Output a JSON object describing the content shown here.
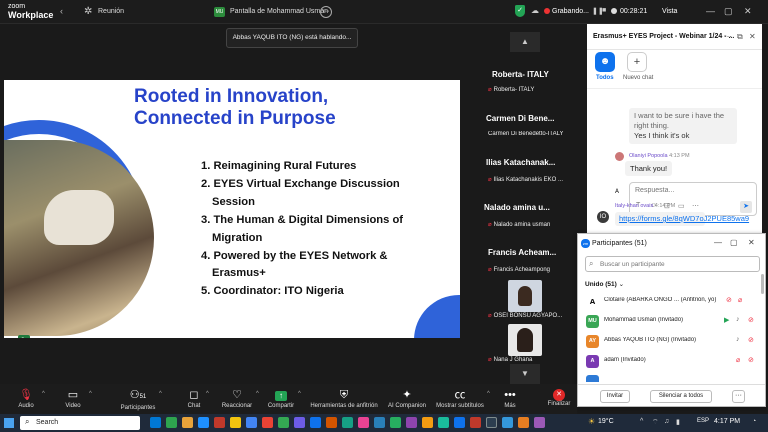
{
  "topbar": {
    "logo_line1": "zoom",
    "logo_line2": "Workplace",
    "meeting_label": "Reunión",
    "share_badge": "MU",
    "share_title": "Pantalla de Mohammad Usman",
    "share_more": "···",
    "recording_label": "Grabando...",
    "timer": "00:28:21",
    "view_label": "Vista"
  },
  "toast": {
    "text": "Abbas YAQUB ITO (NG) está hablando..."
  },
  "slide": {
    "title_line1": "Rooted in Innovation,",
    "title_line2": "Connected in Purpose",
    "items": [
      "1. Reimagining Rural Futures",
      "2. EYES Virtual Exchange Discussion",
      "Session",
      "3. The Human & Digital Dimensions of",
      "Migration",
      "4. Powered by the EYES Network &",
      "Erasmus+",
      "5. Coordinator: ITO Nigeria"
    ]
  },
  "gallery": {
    "tiles": [
      {
        "name": "Roberta- ITALY",
        "sub": "Roberta- ITALY"
      },
      {
        "name": "Carmen Di Bene...",
        "sub": "Carmen Di Benedetto-ITALY"
      },
      {
        "name": "Ilias Katachanak...",
        "sub": "Ilias Katachanakis EKO ..."
      },
      {
        "name": "Nalado amina u...",
        "sub": "Nalado amina usman"
      },
      {
        "name": "Francis Acheam...",
        "sub": "Francis Acheampong"
      },
      {
        "name": "",
        "sub": "OSEI BONSU AGYAPO..."
      },
      {
        "name": "",
        "sub": "Nana J Ghana"
      }
    ]
  },
  "chat": {
    "title": "Erasmus+ EYES Project - Webinar 1/24 - ...",
    "todos_label": "Todos",
    "nuevo_label": "Nuevo chat",
    "msg1_line1": "I want to be sure i have the",
    "msg1_line2": "right thing.",
    "msg1_line3": "Yes I think it's ok",
    "msg2_sender": "Olaniyi Popoola",
    "msg2_time": "4:13 PM",
    "msg2_text": "Thank you!",
    "reply_placeholder": "Respuesta...",
    "msg3_sender": "Italy-khan ovais",
    "msg3_time": "4:14 PM",
    "msg3_link": "https://forms.gle/8qWD7oJ2PUE85wa9"
  },
  "participants": {
    "title": "Participantes (51)",
    "search_placeholder": "Buscar un participante",
    "group_label": "Unido (51)",
    "rows": [
      {
        "initials": "",
        "color": "#2b2b2b",
        "name": "Clotaire (ABARKA ONGO ... (Anfitrión, yo)"
      },
      {
        "initials": "MU",
        "color": "#3aa655",
        "name": "Mohammad Usman (Invitado)"
      },
      {
        "initials": "AY",
        "color": "#e8862a",
        "name": "Abbas YAQUB ITO (NG) (Invitado)"
      },
      {
        "initials": "A",
        "color": "#7a3ab2",
        "name": "adam (Invitado)"
      }
    ],
    "invite_label": "Invitar",
    "mute_all_label": "Silenciar a todos",
    "more_label": "···"
  },
  "toolbar": {
    "audio": "Audio",
    "video": "Video",
    "participants": "Participantes",
    "participants_count": "51",
    "chat": "Chat",
    "react": "Reaccionar",
    "share": "Compartir",
    "host_tools": "Herramientas de anfitrión",
    "ai": "AI Companion",
    "captions": "Mostrar subtítulos",
    "more": "Más",
    "end": "Finalizar"
  },
  "taskbar": {
    "search": "Search",
    "weather": "19°C",
    "lang": "ESP",
    "time": "4:17 PM"
  },
  "colors": {
    "accent": "#0e72ed",
    "share_green": "#23a455",
    "leave_red": "#e02828"
  }
}
